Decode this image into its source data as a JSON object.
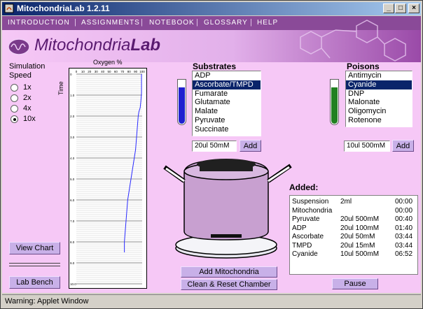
{
  "window": {
    "title": "MitochondriaLab 1.2.11",
    "min_label": "_",
    "max_label": "□",
    "close_label": "×"
  },
  "menu": {
    "items": [
      "INTRODUCTION",
      "ASSIGNMENTS",
      "NOTEBOOK",
      "GLOSSARY",
      "HELP"
    ],
    "separator": "|"
  },
  "logo": {
    "part1": "Mitochondria",
    "part2": "Lab"
  },
  "simulation": {
    "title_line1": "Simulation",
    "title_line2": "Speed",
    "options": [
      "1x",
      "2x",
      "4x",
      "10x"
    ],
    "selected": "10x"
  },
  "chart_data": {
    "type": "line",
    "title": "Oxygen %",
    "ylabel": "Time",
    "x_ticks": [
      "0",
      "10",
      "20",
      "30",
      "40",
      "50",
      "60",
      "70",
      "80",
      "90",
      "100"
    ],
    "y_ticks": [
      "0",
      "1.0",
      "2.0",
      "3.0",
      "4.0",
      "5.0",
      "6.0",
      "7.0",
      "8.0",
      "9.0",
      "10.0"
    ],
    "xlim": [
      0,
      100
    ],
    "ylim": [
      0,
      10
    ],
    "x": [
      99,
      99,
      99,
      98,
      97,
      95,
      94,
      93,
      92,
      91,
      90,
      88,
      86,
      84,
      82,
      80,
      78,
      77,
      76,
      75,
      74,
      73,
      73
    ],
    "y": [
      0,
      0.4,
      0.9,
      1.3,
      1.6,
      1.8,
      2.0,
      2.4,
      2.8,
      3.2,
      3.6,
      4.0,
      4.4,
      4.8,
      5.2,
      5.6,
      6.0,
      6.4,
      6.8,
      7.2,
      7.6,
      8.0,
      8.5
    ],
    "line_color": "#2a2aff"
  },
  "substrates": {
    "title": "Substrates",
    "items": [
      "ADP",
      "Ascorbate/TMPD",
      "Fumarate",
      "Glutamate",
      "Malate",
      "Pyruvate",
      "Succinate"
    ],
    "selected": "Ascorbate/TMPD",
    "amount": "20ul  50mM",
    "add_label": "Add"
  },
  "poisons": {
    "title": "Poisons",
    "items": [
      "Antimycin",
      "Cyanide",
      "DNP",
      "Malonate",
      "Oligomycin",
      "Rotenone"
    ],
    "selected": "Cyanide",
    "amount": "10ul 500mM",
    "add_label": "Add"
  },
  "added": {
    "title": "Added:",
    "rows": [
      {
        "name": "Suspension",
        "amount": "2ml",
        "time": "00:00"
      },
      {
        "name": "Mitochondria",
        "amount": "",
        "time": "00:00"
      },
      {
        "name": "Pyruvate",
        "amount": "20ul 500mM",
        "time": "00:40"
      },
      {
        "name": "ADP",
        "amount": "20ul 100mM",
        "time": "01:40"
      },
      {
        "name": "Ascorbate",
        "amount": "20ul  50mM",
        "time": "03:44"
      },
      {
        "name": "TMPD",
        "amount": "20ul  15mM",
        "time": "03:44"
      },
      {
        "name": "Cyanide",
        "amount": "10ul 500mM",
        "time": "06:52"
      }
    ]
  },
  "buttons": {
    "view_chart": "View Chart",
    "lab_bench": "Lab Bench",
    "add_mito": "Add Mitochondria",
    "clean_reset": "Clean & Reset Chamber",
    "pause": "Pause"
  },
  "status": {
    "text": "Warning: Applet Window"
  },
  "colors": {
    "menu_bg": "#8a4a98",
    "panel_bg": "#f6c8f6",
    "button_bg": "#c8b0e8",
    "selection": "#0a246a",
    "substrate_tube": "#2020d0",
    "poison_tube": "#208020"
  }
}
